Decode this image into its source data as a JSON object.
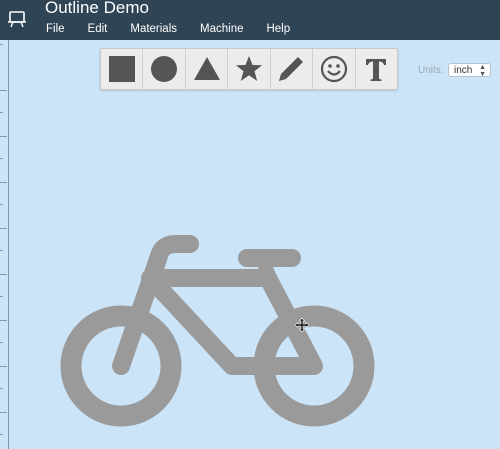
{
  "app": {
    "title": "Outline Demo"
  },
  "menu": {
    "items": [
      "File",
      "Edit",
      "Materials",
      "Machine",
      "Help"
    ]
  },
  "toolbar": {
    "tools": [
      {
        "name": "square-tool",
        "icon": "square-icon"
      },
      {
        "name": "circle-tool",
        "icon": "circle-icon"
      },
      {
        "name": "triangle-tool",
        "icon": "triangle-icon"
      },
      {
        "name": "star-tool",
        "icon": "star-icon"
      },
      {
        "name": "pencil-tool",
        "icon": "pencil-icon"
      },
      {
        "name": "emoji-tool",
        "icon": "smiley-icon"
      },
      {
        "name": "text-tool",
        "icon": "text-icon"
      }
    ]
  },
  "units": {
    "label": "Units:",
    "value": "inch"
  },
  "colors": {
    "header": "#2f4556",
    "canvas": "#cce4f7",
    "shape": "#9a9a9a",
    "toolbar_icon": "#555555"
  }
}
